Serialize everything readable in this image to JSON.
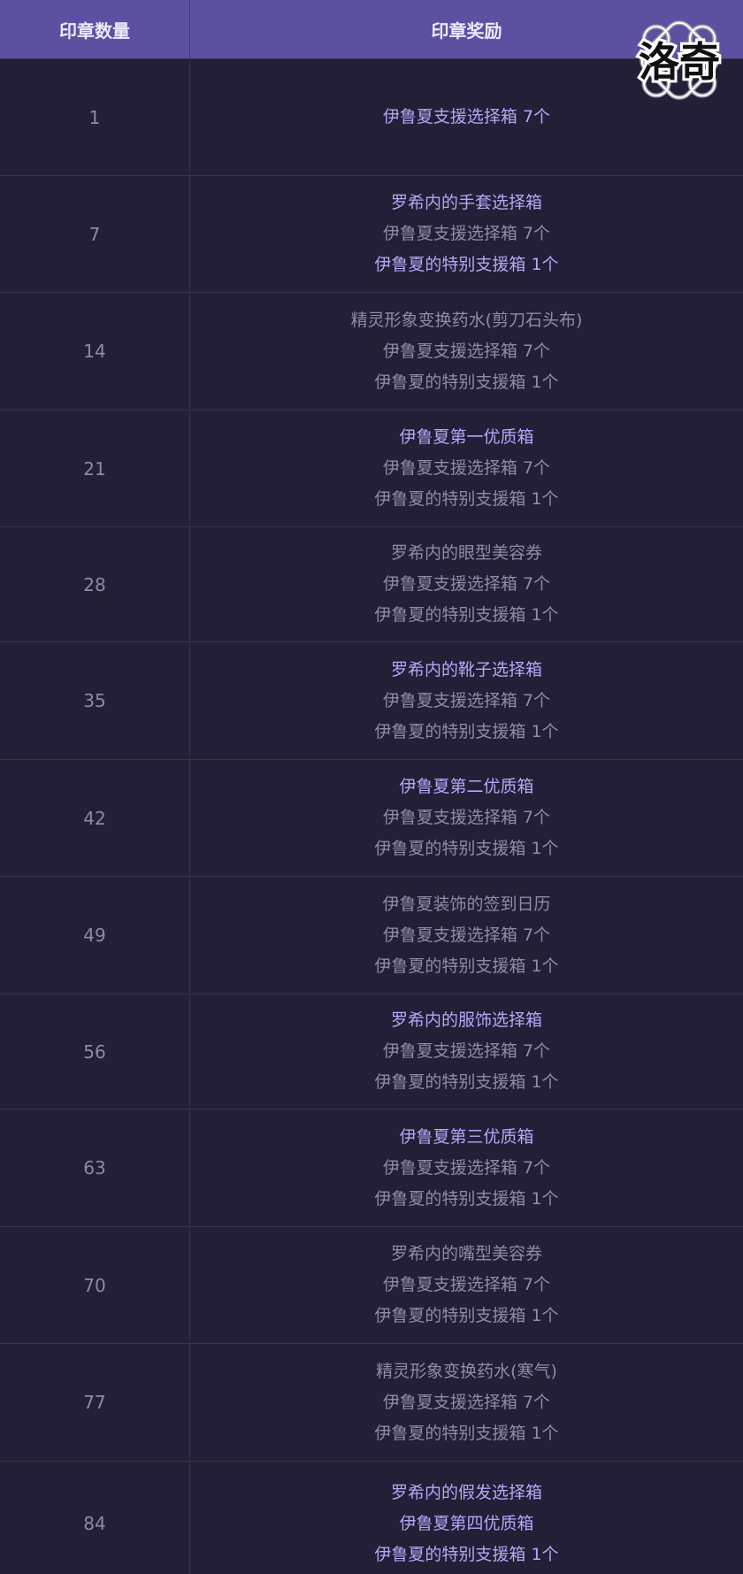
{
  "header": {
    "col_count": "印章数量",
    "col_reward": "印章奖励"
  },
  "logo": {
    "text": "洛奇",
    "icon": "knot-emblem-icon"
  },
  "colors": {
    "header_bg": "#5c51a0",
    "body_bg": "#221f36",
    "highlight_text": "#b7a6f6",
    "normal_text": "#8f8ba8"
  },
  "rows": [
    {
      "count": "1",
      "rewards": [
        {
          "text": "伊鲁夏支援选择箱 7个",
          "hl": true
        }
      ]
    },
    {
      "count": "7",
      "rewards": [
        {
          "text": "罗希内的手套选择箱",
          "hl": true
        },
        {
          "text": "伊鲁夏支援选择箱 7个",
          "hl": false
        },
        {
          "text": "伊鲁夏的特别支援箱 1个",
          "hl": true
        }
      ]
    },
    {
      "count": "14",
      "rewards": [
        {
          "text": "精灵形象变换药水(剪刀石头布)",
          "hl": false
        },
        {
          "text": "伊鲁夏支援选择箱 7个",
          "hl": false
        },
        {
          "text": "伊鲁夏的特别支援箱 1个",
          "hl": false
        }
      ]
    },
    {
      "count": "21",
      "rewards": [
        {
          "text": "伊鲁夏第一优质箱",
          "hl": true
        },
        {
          "text": "伊鲁夏支援选择箱 7个",
          "hl": false
        },
        {
          "text": "伊鲁夏的特别支援箱 1个",
          "hl": false
        }
      ]
    },
    {
      "count": "28",
      "rewards": [
        {
          "text": "罗希内的眼型美容券",
          "hl": false
        },
        {
          "text": "伊鲁夏支援选择箱 7个",
          "hl": false
        },
        {
          "text": "伊鲁夏的特别支援箱 1个",
          "hl": false
        }
      ]
    },
    {
      "count": "35",
      "rewards": [
        {
          "text": "罗希内的靴子选择箱",
          "hl": true
        },
        {
          "text": "伊鲁夏支援选择箱 7个",
          "hl": false
        },
        {
          "text": "伊鲁夏的特别支援箱 1个",
          "hl": false
        }
      ]
    },
    {
      "count": "42",
      "rewards": [
        {
          "text": "伊鲁夏第二优质箱",
          "hl": true
        },
        {
          "text": "伊鲁夏支援选择箱 7个",
          "hl": false
        },
        {
          "text": "伊鲁夏的特别支援箱 1个",
          "hl": false
        }
      ]
    },
    {
      "count": "49",
      "rewards": [
        {
          "text": "伊鲁夏装饰的签到日历",
          "hl": false
        },
        {
          "text": "伊鲁夏支援选择箱 7个",
          "hl": false
        },
        {
          "text": "伊鲁夏的特别支援箱 1个",
          "hl": false
        }
      ]
    },
    {
      "count": "56",
      "rewards": [
        {
          "text": "罗希内的服饰选择箱",
          "hl": true
        },
        {
          "text": "伊鲁夏支援选择箱 7个",
          "hl": false
        },
        {
          "text": "伊鲁夏的特别支援箱 1个",
          "hl": false
        }
      ]
    },
    {
      "count": "63",
      "rewards": [
        {
          "text": "伊鲁夏第三优质箱",
          "hl": true
        },
        {
          "text": "伊鲁夏支援选择箱 7个",
          "hl": false
        },
        {
          "text": "伊鲁夏的特别支援箱 1个",
          "hl": false
        }
      ]
    },
    {
      "count": "70",
      "rewards": [
        {
          "text": "罗希内的嘴型美容券",
          "hl": false
        },
        {
          "text": "伊鲁夏支援选择箱 7个",
          "hl": false
        },
        {
          "text": "伊鲁夏的特别支援箱 1个",
          "hl": false
        }
      ]
    },
    {
      "count": "77",
      "rewards": [
        {
          "text": "精灵形象变换药水(寒气)",
          "hl": false
        },
        {
          "text": "伊鲁夏支援选择箱 7个",
          "hl": false
        },
        {
          "text": "伊鲁夏的特别支援箱 1个",
          "hl": false
        }
      ]
    },
    {
      "count": "84",
      "rewards": [
        {
          "text": "罗希内的假发选择箱",
          "hl": true
        },
        {
          "text": "伊鲁夏第四优质箱",
          "hl": true
        },
        {
          "text": "伊鲁夏的特别支援箱 1个",
          "hl": true
        }
      ]
    }
  ]
}
